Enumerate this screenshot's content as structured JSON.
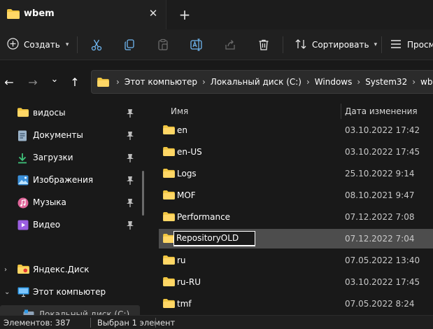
{
  "window": {
    "tab_title": "wbem",
    "close_tab_glyph": "✕",
    "new_tab_glyph": "+"
  },
  "toolbar": {
    "create_label": "Создать",
    "sort_label": "Сортировать",
    "view_label": "Просм",
    "icons": [
      "cut-icon",
      "copy-icon",
      "paste-icon",
      "rename-icon",
      "share-icon",
      "delete-icon"
    ]
  },
  "nav": {
    "back": "←",
    "forward": "→",
    "expand": "⌄",
    "up": "↑"
  },
  "breadcrumb": [
    "Этот компьютер",
    "Локальный диск (C:)",
    "Windows",
    "System32",
    "wbem"
  ],
  "breadcrumb_separator": "›",
  "sidebar": {
    "items": [
      {
        "label": "видосы",
        "icon": "folder-icon",
        "pinned": true
      },
      {
        "label": "Документы",
        "icon": "documents-icon",
        "pinned": true
      },
      {
        "label": "Загрузки",
        "icon": "downloads-icon",
        "pinned": true
      },
      {
        "label": "Изображения",
        "icon": "pictures-icon",
        "pinned": true
      },
      {
        "label": "Музыка",
        "icon": "music-icon",
        "pinned": true
      },
      {
        "label": "Видео",
        "icon": "videos-icon",
        "pinned": true
      },
      {
        "label": "Яндекс.Диск",
        "icon": "yandex-disk-icon",
        "expander": "›"
      },
      {
        "label": "Этот компьютер",
        "icon": "this-pc-icon",
        "expander": "⌄"
      },
      {
        "label": "Локальный диск (C:)",
        "icon": "drive-icon"
      }
    ]
  },
  "filelist": {
    "columns": {
      "name": "Имя",
      "date": "Дата изменения",
      "sort_glyph": "⌃"
    },
    "rows": [
      {
        "name": "en",
        "date": "03.10.2022 17:42"
      },
      {
        "name": "en-US",
        "date": "03.10.2022 17:45"
      },
      {
        "name": "Logs",
        "date": "25.10.2022 9:14"
      },
      {
        "name": "MOF",
        "date": "08.10.2021 9:47"
      },
      {
        "name": "Performance",
        "date": "07.12.2022 7:08"
      },
      {
        "name": "RepositoryOLD",
        "date": "07.12.2022 7:04",
        "selected": true,
        "renaming": true
      },
      {
        "name": "ru",
        "date": "07.05.2022 13:40"
      },
      {
        "name": "ru-RU",
        "date": "03.10.2022 17:45"
      },
      {
        "name": "tmf",
        "date": "07.05.2022 8:24"
      }
    ]
  },
  "status": {
    "items_count": "Элементов: 387",
    "selected": "Выбран 1 элемент"
  },
  "colors": {
    "folder": "#f0c541",
    "accent": "#4cc2ff"
  }
}
